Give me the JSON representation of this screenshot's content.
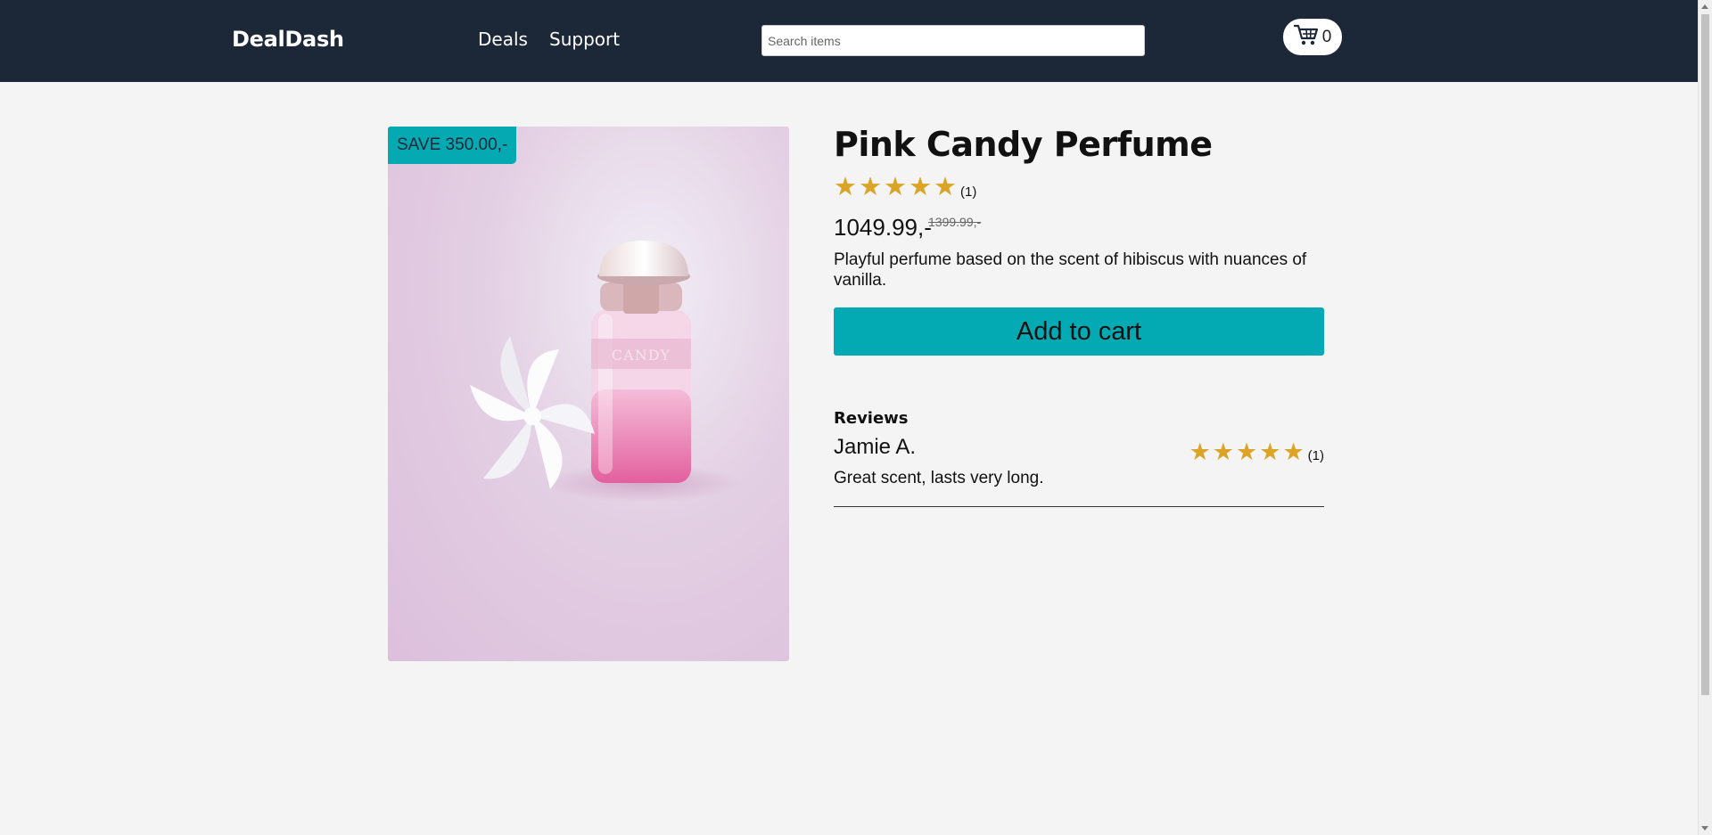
{
  "header": {
    "logo": "DealDash",
    "nav": {
      "deals": "Deals",
      "support": "Support"
    },
    "search": {
      "placeholder": "Search items",
      "value": ""
    },
    "cart": {
      "count": "0",
      "icon": "cart-icon"
    }
  },
  "product": {
    "badge": "SAVE 350.00,-",
    "title": "Pink Candy Perfume",
    "rating": {
      "stars": 5,
      "count": "(1)"
    },
    "price": "1049.99,-",
    "old_price": "1399.99,-",
    "description": "Playful perfume based on the scent of hibiscus with nuances of vanilla.",
    "add_to_cart": "Add to cart",
    "image": {
      "bottle_label": "CANDY"
    }
  },
  "reviews": {
    "heading": "Reviews",
    "items": [
      {
        "name": "Jamie A.",
        "stars": 5,
        "count": "(1)",
        "text": "Great scent, lasts very long."
      }
    ]
  },
  "colors": {
    "header_bg": "#1c2738",
    "accent": "#04aab3",
    "star": "#dba426",
    "page_bg": "#f4f4f4"
  }
}
